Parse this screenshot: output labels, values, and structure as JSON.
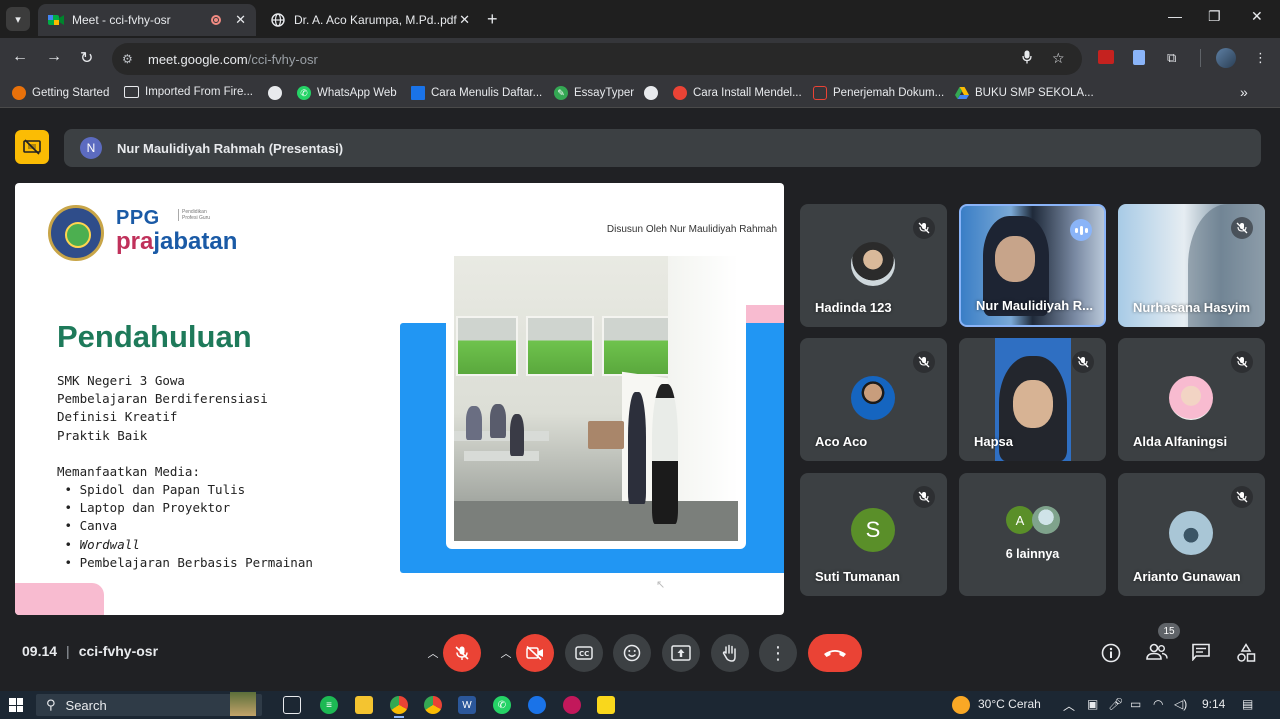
{
  "browser": {
    "tabs": [
      {
        "title": "Meet - cci-fvhy-osr",
        "active": true,
        "recording": true
      },
      {
        "title": "Dr. A. Aco Karumpa, M.Pd..pdf",
        "active": false
      }
    ],
    "new_tab": "+",
    "window_controls": {
      "minimize": "—",
      "restore": "❐",
      "close": "✕"
    },
    "nav": {
      "back": "←",
      "forward": "→",
      "reload": "↻"
    },
    "url_host": "meet.google.com",
    "url_path": "/cci-fvhy-osr",
    "bookmarks": [
      {
        "label": "Getting Started",
        "color": "#e8710a"
      },
      {
        "label": "Imported From Fire...",
        "color": "folder"
      },
      {
        "label": "",
        "color": "#9aa0a6"
      },
      {
        "label": "WhatsApp Web",
        "color": "#25d366"
      },
      {
        "label": "Cara Menulis Daftar...",
        "color": "#1a73e8"
      },
      {
        "label": "EssayTyper",
        "color": "#34a853"
      },
      {
        "label": "",
        "color": "#9aa0a6"
      },
      {
        "label": "Cara Install Mendel...",
        "color": "#ea4335"
      },
      {
        "label": "Penerjemah Dokum...",
        "color": "#ea4335"
      },
      {
        "label": "BUKU SMP SEKOLA...",
        "color": "#fbbc04"
      }
    ],
    "more_bookmarks": "»"
  },
  "meet": {
    "presenter": {
      "initial": "N",
      "label": "Nur Maulidiyah Rahmah (Presentasi)"
    },
    "slide": {
      "logo_ppg": "PPG",
      "logo_tagline": "Pendidikan Profesi Guru",
      "logo_pra": "pra",
      "logo_jabatan": "jabatan",
      "byline": "Disusun Oleh Nur Maulidiyah Rahmah",
      "heading": "Pendahuluan",
      "items": [
        "SMK Negeri 3 Gowa",
        "Pembelajaran Berdiferensiasi",
        "Definisi Kreatif",
        "Praktik Baik"
      ],
      "media_title": "Memanfaatkan Media:",
      "media": [
        "Spidol dan Papan Tulis",
        "Laptop dan Proyektor",
        "Canva",
        "Wordwall",
        "Pembelajaran Berbasis Permainan"
      ]
    },
    "participants": [
      {
        "name": "Hadinda 123",
        "muted": true
      },
      {
        "name": "Nur Maulidiyah R...",
        "speaking": true
      },
      {
        "name": "Nurhasana Hasyim",
        "muted": true
      },
      {
        "name": "Aco Aco",
        "muted": true
      },
      {
        "name": "Hapsa",
        "muted": true
      },
      {
        "name": "Alda Alfaningsi",
        "muted": true
      },
      {
        "name": "Suti Tumanan",
        "initial": "S",
        "muted": true
      },
      {
        "name": "6 lainnya",
        "initial": "A"
      },
      {
        "name": "Arianto Gunawan",
        "muted": true
      }
    ],
    "time": "09.14",
    "meeting_code": "cci-fvhy-osr",
    "people_count": "15",
    "colors": {
      "red": "#ea4335",
      "accent": "#8ab4f8",
      "present_yellow": "#fbbc04"
    }
  },
  "taskbar": {
    "search_label": "Search",
    "weather": "30°C Cerah",
    "time": "9:14"
  }
}
